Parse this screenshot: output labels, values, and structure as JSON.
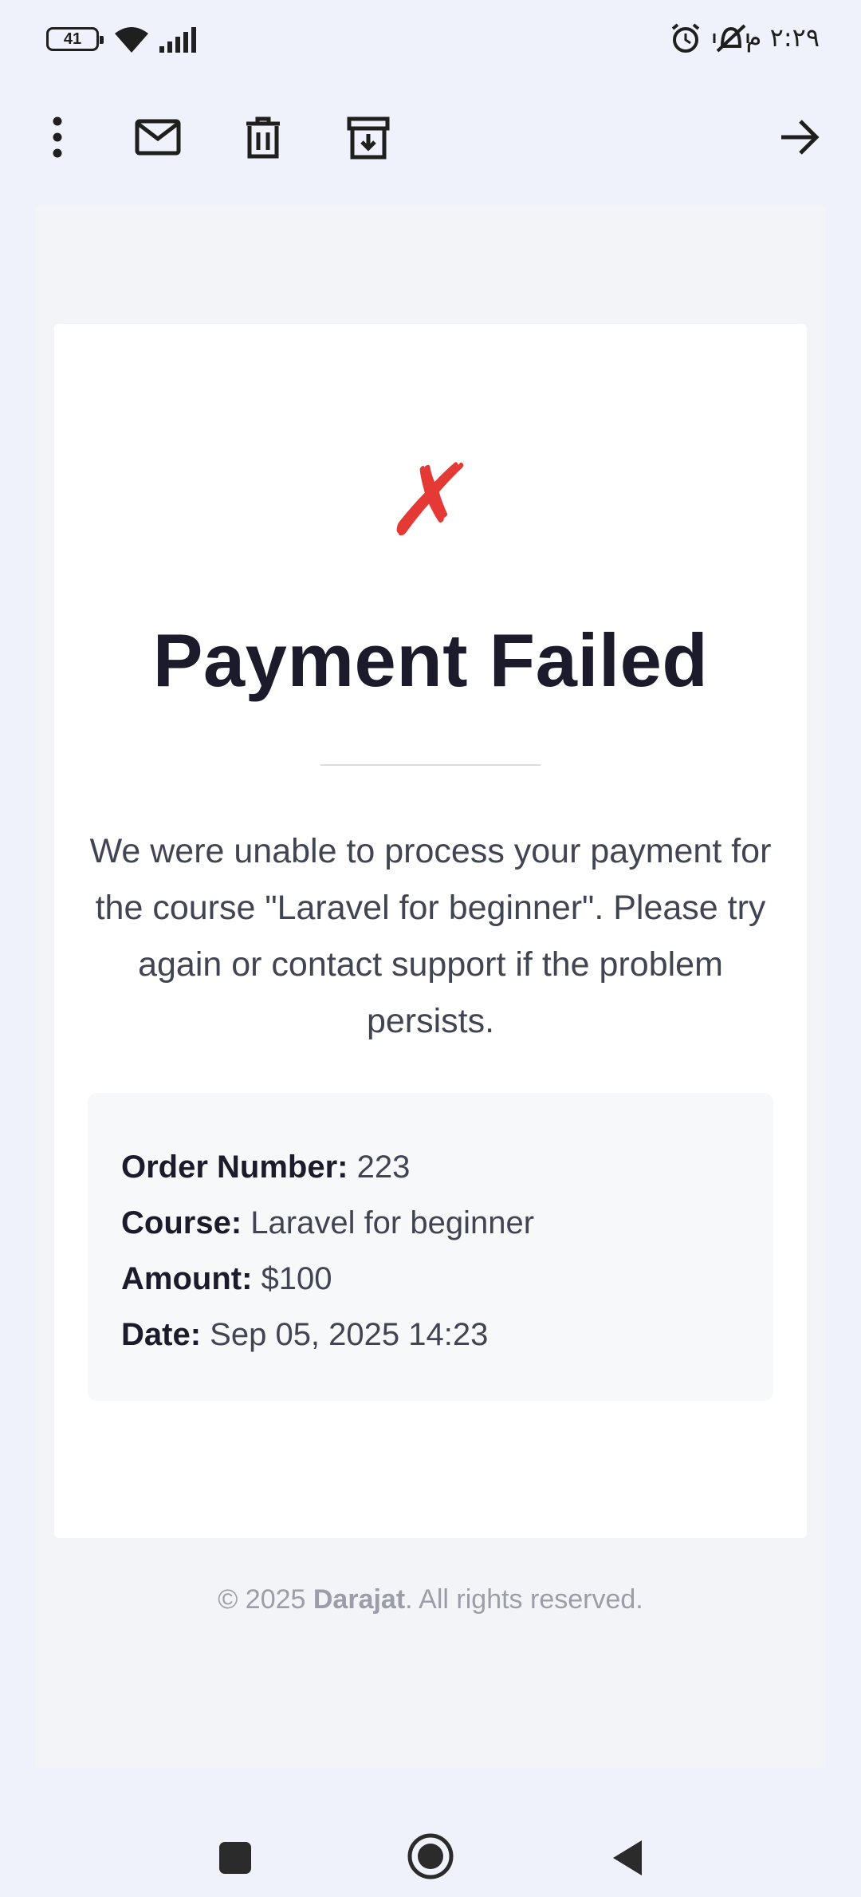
{
  "status_bar": {
    "battery_level": "41",
    "time": "٢:٢٩ م",
    "icons": [
      "battery-icon",
      "wifi-icon",
      "signal-icon",
      "alarm-icon",
      "vibrate-icon"
    ]
  },
  "toolbar": {
    "icons": [
      "more-vert-icon",
      "mail-icon",
      "delete-icon",
      "archive-icon",
      "forward-arrow-icon"
    ]
  },
  "email": {
    "status_symbol": "✗",
    "title": "Payment Failed",
    "message": "We were unable to process your payment for the course \"Laravel for beginner\". Please try again or contact support if the problem persists.",
    "details": [
      {
        "label": "Order Number:",
        "value": "223"
      },
      {
        "label": "Course:",
        "value": "Laravel for beginner"
      },
      {
        "label": "Amount:",
        "value": "$100"
      },
      {
        "label": "Date:",
        "value": "Sep 05, 2025 14:23"
      }
    ],
    "footer": {
      "prefix": "© 2025 ",
      "brand": "Darajat",
      "suffix": ". All rights reserved."
    }
  },
  "colors": {
    "fail_red": "#e53935",
    "title": "#1b1b2b",
    "body_text": "#414452",
    "background": "#eff2fa"
  },
  "nav_bar": {
    "icons": [
      "recents-icon",
      "home-icon",
      "back-icon"
    ]
  }
}
